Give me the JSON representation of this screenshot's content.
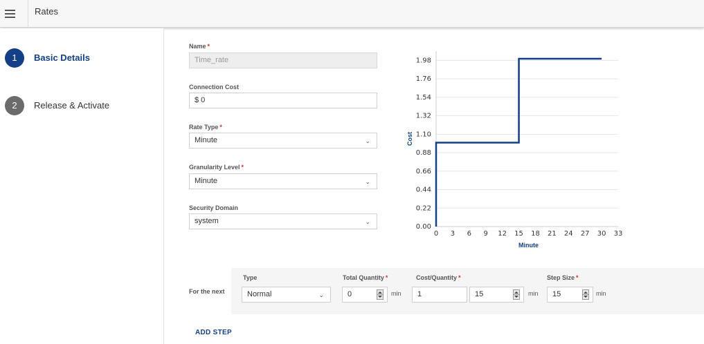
{
  "header": {
    "title": "Rates"
  },
  "wizard": {
    "steps": [
      {
        "number": "1",
        "label": "Basic Details"
      },
      {
        "number": "2",
        "label": "Release & Activate"
      }
    ],
    "active_step": 1
  },
  "form": {
    "name": {
      "label": "Name",
      "value": "Time_rate"
    },
    "connection_cost": {
      "label": "Connection Cost",
      "value": "$ 0"
    },
    "rate_type": {
      "label": "Rate Type",
      "value": "Minute"
    },
    "granularity_level": {
      "label": "Granularity Level",
      "value": "Minute"
    },
    "security_domain": {
      "label": "Security Domain",
      "value": "system"
    },
    "required_marker": "*"
  },
  "rate_step": {
    "row_label": "For the next",
    "type": {
      "label": "Type",
      "value": "Normal"
    },
    "total_quantity": {
      "label": "Total Quantity",
      "value": "0",
      "unit": "min"
    },
    "cost_per_quantity": {
      "label": "Cost/Quantity",
      "cost_value": "1",
      "quantity_value": "15",
      "unit": "min"
    },
    "step_size": {
      "label": "Step Size",
      "value": "15",
      "unit": "min"
    },
    "add_step_label": "ADD STEP"
  },
  "colors": {
    "accent": "#123f85",
    "required": "#c0392b",
    "inactive_step": "#6b6b6b"
  },
  "chart_data": {
    "type": "line",
    "step": true,
    "xlabel": "Minute",
    "ylabel": "Cost",
    "xlim": [
      0,
      33
    ],
    "ylim": [
      0,
      2.09
    ],
    "x_ticks": [
      "0",
      "3",
      "6",
      "9",
      "12",
      "15",
      "18",
      "21",
      "24",
      "27",
      "30",
      "33"
    ],
    "y_ticks": [
      "0.00",
      "0.22",
      "0.44",
      "0.66",
      "0.88",
      "1.10",
      "1.32",
      "1.54",
      "1.76",
      "1.98"
    ],
    "grid": true,
    "series": [
      {
        "points": [
          [
            0,
            0
          ],
          [
            0,
            1
          ],
          [
            15,
            1
          ],
          [
            15,
            2
          ],
          [
            30,
            2
          ]
        ]
      }
    ]
  }
}
